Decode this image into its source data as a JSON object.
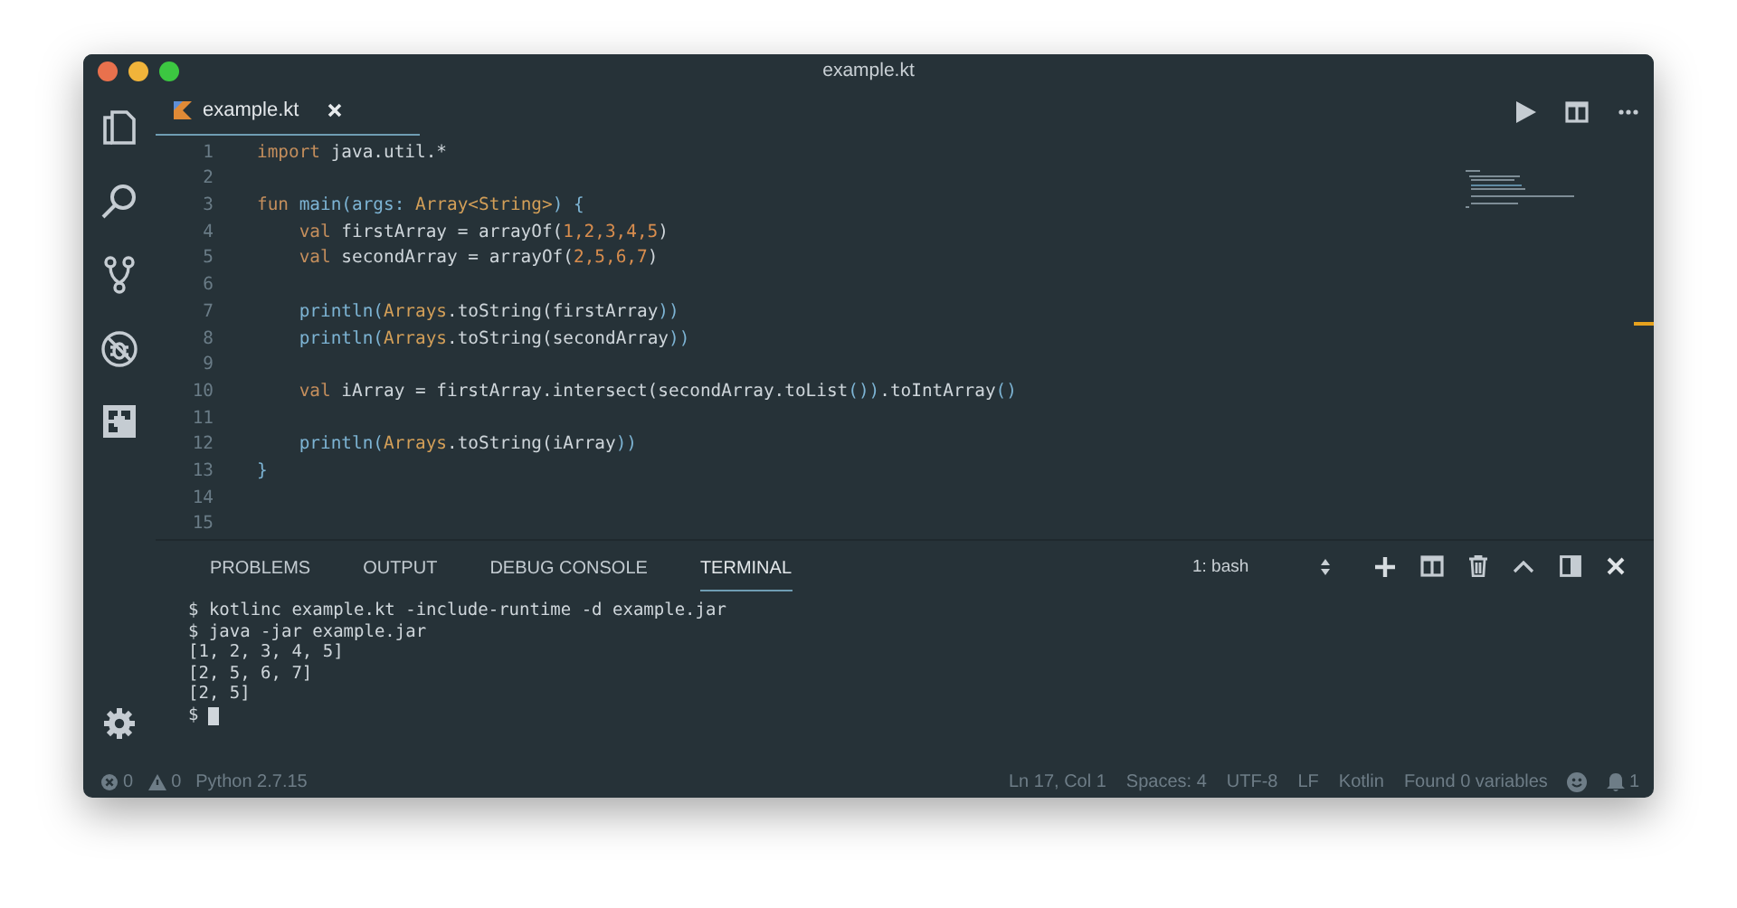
{
  "window": {
    "title": "example.kt"
  },
  "activity_bar": [
    {
      "kind": "files"
    },
    {
      "kind": "search"
    },
    {
      "kind": "branch"
    },
    {
      "kind": "debug"
    },
    {
      "kind": "extensions"
    }
  ],
  "settings": {
    "kind": "settings"
  },
  "tabs": [
    {
      "label": "example.kt",
      "selected": true
    }
  ],
  "editor_actions": [
    {
      "kind": "run"
    },
    {
      "kind": "split"
    },
    {
      "kind": "more"
    }
  ],
  "editor": {
    "lines": [
      {
        "number": "1",
        "tokens": [
          {
            "kind": "keyword",
            "text": "import"
          },
          {
            "kind": "plain",
            "text": " java.util.*"
          }
        ]
      },
      {
        "number": "2"
      },
      {
        "number": "3",
        "tokens": [
          {
            "kind": "keyword",
            "text": "fun"
          },
          {
            "kind": "function",
            "text": " main(args: "
          },
          {
            "kind": "type",
            "text": "Array<String>"
          },
          {
            "kind": "function",
            "text": ") {"
          }
        ]
      },
      {
        "number": "4",
        "tokens": [
          {
            "kind": "keyword",
            "text": "    val"
          },
          {
            "kind": "plain",
            "text": " firstArray = arrayOf("
          },
          {
            "kind": "number",
            "text": "1,2,3,4,5"
          },
          {
            "kind": "plain",
            "text": ")"
          }
        ]
      },
      {
        "number": "5",
        "tokens": [
          {
            "kind": "keyword",
            "text": "    val"
          },
          {
            "kind": "plain",
            "text": " secondArray = arrayOf("
          },
          {
            "kind": "number",
            "text": "2,5,6,7"
          },
          {
            "kind": "plain",
            "text": ")"
          }
        ]
      },
      {
        "number": "6"
      },
      {
        "number": "7",
        "tokens": [
          {
            "kind": "function",
            "text": "    println("
          },
          {
            "kind": "type",
            "text": "Arrays"
          },
          {
            "kind": "plain",
            "text": ".toString(firstArray"
          },
          {
            "kind": "function",
            "text": "))"
          }
        ]
      },
      {
        "number": "8",
        "tokens": [
          {
            "kind": "function",
            "text": "    println("
          },
          {
            "kind": "type",
            "text": "Arrays"
          },
          {
            "kind": "plain",
            "text": ".toString(secondArray"
          },
          {
            "kind": "function",
            "text": "))"
          }
        ]
      },
      {
        "number": "9"
      },
      {
        "number": "10",
        "tokens": [
          {
            "kind": "keyword",
            "text": "    val"
          },
          {
            "kind": "plain",
            "text": " iArray = firstArray.intersect(secondArray.toList"
          },
          {
            "kind": "function",
            "text": "())"
          },
          {
            "kind": "plain",
            "text": ".toIntArray"
          },
          {
            "kind": "function",
            "text": "()"
          }
        ]
      },
      {
        "number": "11"
      },
      {
        "number": "12",
        "tokens": [
          {
            "kind": "function",
            "text": "    println("
          },
          {
            "kind": "type",
            "text": "Arrays"
          },
          {
            "kind": "plain",
            "text": ".toString(iArray"
          },
          {
            "kind": "function",
            "text": "))"
          }
        ]
      },
      {
        "number": "13",
        "tokens": [
          {
            "kind": "function",
            "text": "}"
          }
        ]
      },
      {
        "number": "14"
      },
      {
        "number": "15"
      }
    ]
  },
  "panel": {
    "tabs": [
      {
        "label": "PROBLEMS",
        "selected": false
      },
      {
        "label": "OUTPUT",
        "selected": false
      },
      {
        "label": "DEBUG CONSOLE",
        "selected": false
      },
      {
        "label": "TERMINAL",
        "selected": true
      }
    ],
    "terminal_select": "1: bash",
    "actions": [
      {
        "kind": "add"
      },
      {
        "kind": "split"
      },
      {
        "kind": "trash"
      },
      {
        "kind": "chevron"
      },
      {
        "kind": "panel"
      },
      {
        "kind": "close"
      }
    ],
    "lines": [
      "$ kotlinc example.kt -include-runtime -d example.jar",
      "$ java -jar example.jar",
      "[1, 2, 3, 4, 5]",
      "[2, 5, 6, 7]",
      "[2, 5]"
    ],
    "prompt": "$"
  },
  "status_bar": {
    "errors": "0",
    "warnings": "0",
    "left": [
      "Python 2.7.15"
    ],
    "right": [
      "Ln 17, Col 1",
      "Spaces: 4",
      "UTF-8",
      "LF",
      "Kotlin",
      "Found 0 variables"
    ],
    "notifications": "1"
  }
}
